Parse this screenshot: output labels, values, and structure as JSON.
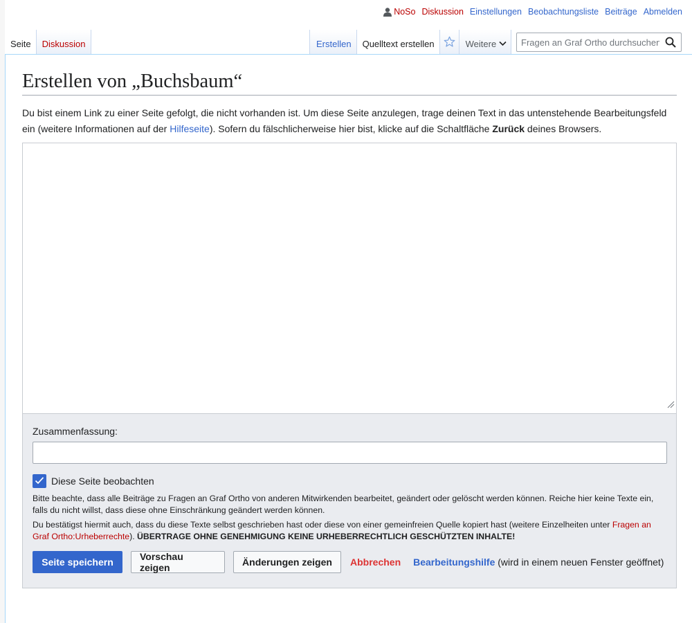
{
  "user_menu": {
    "username": "NoSo",
    "talk": "Diskussion",
    "preferences": "Einstellungen",
    "watchlist": "Beobachtungsliste",
    "contributions": "Beiträge",
    "logout": "Abmelden"
  },
  "namespaces": {
    "page": "Seite",
    "talk": "Diskussion"
  },
  "views": {
    "create": "Erstellen",
    "create_source": "Quelltext erstellen",
    "more": "Weitere"
  },
  "search": {
    "placeholder": "Fragen an Graf Ortho durchsuchen"
  },
  "page": {
    "title": "Erstellen von „Buchsbaum“",
    "intro_part1": "Du bist einem Link zu einer Seite gefolgt, die nicht vorhanden ist. Um diese Seite anzulegen, trage deinen Text in das untenstehende Bearbeitungsfeld ein (weitere Informationen auf der ",
    "intro_link": "Hilfeseite",
    "intro_part2": "). Sofern du fälschlicherweise hier bist, klicke auf die Schaltfläche ",
    "intro_bold": "Zurück",
    "intro_part3": " deines Browsers."
  },
  "edit_form": {
    "textbox_value": "",
    "summary_label": "Zusammenfassung:",
    "summary_value": "",
    "watch_label": "Diese Seite beobachten",
    "watch_checked": true,
    "notice1": "Bitte beachte, dass alle Beiträge zu Fragen an Graf Ortho von anderen Mitwirkenden bearbeitet, geändert oder gelöscht werden können. Reiche hier keine Texte ein, falls du nicht willst, dass diese ohne Einschränkung geändert werden können.",
    "notice2_part1": "Du bestätigst hiermit auch, dass du diese Texte selbst geschrieben hast oder diese von einer gemeinfreien Quelle kopiert hast (weitere Einzelheiten unter ",
    "notice2_link": "Fragen an Graf Ortho:Urheberrechte",
    "notice2_part2": "). ",
    "notice2_bold": "ÜBERTRAGE OHNE GENEHMIGUNG KEINE URHEBERRECHTLICH GESCHÜTZTEN INHALTE!",
    "save": "Seite speichern",
    "preview": "Vorschau zeigen",
    "diff": "Änderungen zeigen",
    "cancel": "Abbrechen",
    "help": "Bearbeitungshilfe",
    "help_note": " (wird in einem neuen Fenster geöffnet)"
  },
  "colors": {
    "link": "#3366cc",
    "new_link": "#ba0000",
    "cancel": "#d33",
    "primary": "#3366cc",
    "options_bg": "#eaecf0"
  },
  "icons": [
    "user-icon",
    "star-icon",
    "chevron-down-icon",
    "search-icon",
    "checkmark-icon",
    "resize-grip-icon"
  ]
}
